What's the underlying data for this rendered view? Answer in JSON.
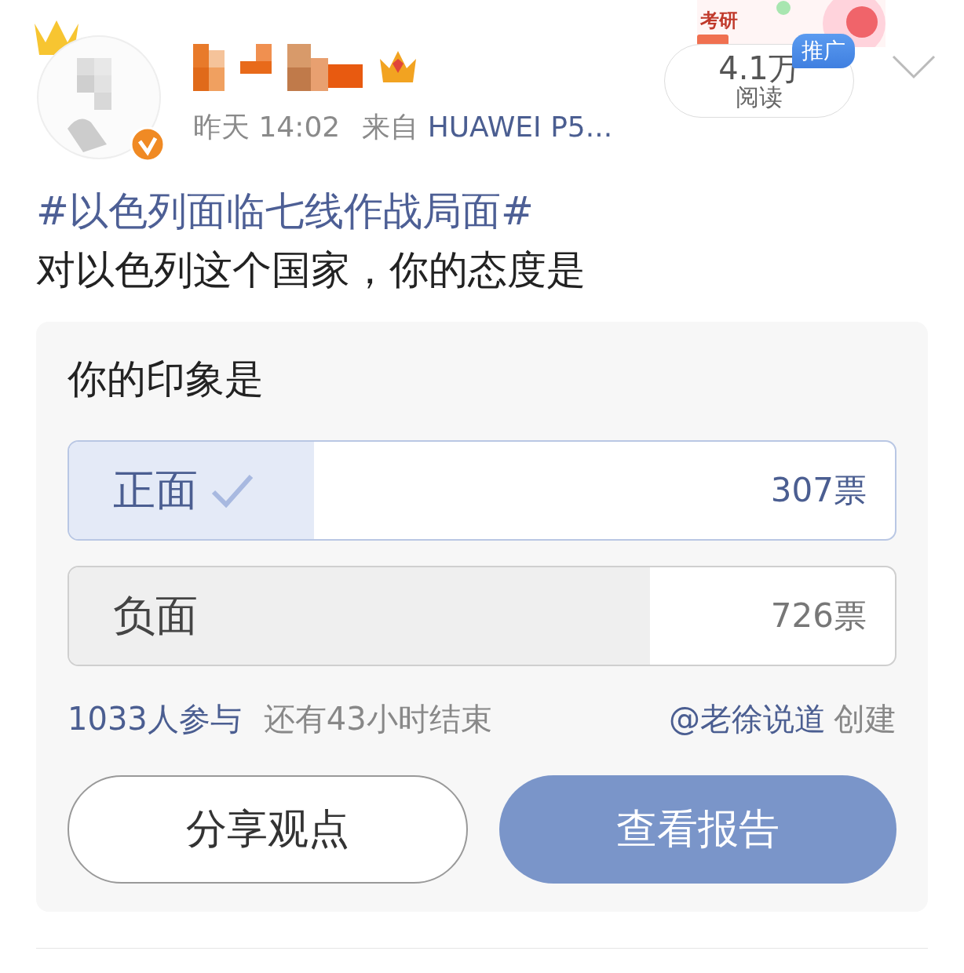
{
  "header": {
    "promo_banner": {
      "text": "考研"
    },
    "time": "昨天 14:02",
    "source_prefix": "来自",
    "source": "HUAWEI P5...",
    "reads": {
      "count": "4.1万",
      "label": "阅读",
      "badge": "推广"
    }
  },
  "post": {
    "hashtag": "#以色列面临七线作战局面#",
    "text": "对以色列这个国家，你的态度是"
  },
  "poll": {
    "title": "你的印象是",
    "options": [
      {
        "label": "正面",
        "votes": "307票",
        "level": 0.297,
        "selected": true
      },
      {
        "label": "负面",
        "votes": "726票",
        "level": 0.703,
        "selected": false
      }
    ],
    "participants": "1033人参与",
    "remaining": "还有43小时结束",
    "creator": "@老徐说道",
    "created_label": "创建",
    "buttons": [
      {
        "label": "分享观点",
        "kind": "outline"
      },
      {
        "label": "查看报告",
        "kind": "primary"
      }
    ]
  }
}
